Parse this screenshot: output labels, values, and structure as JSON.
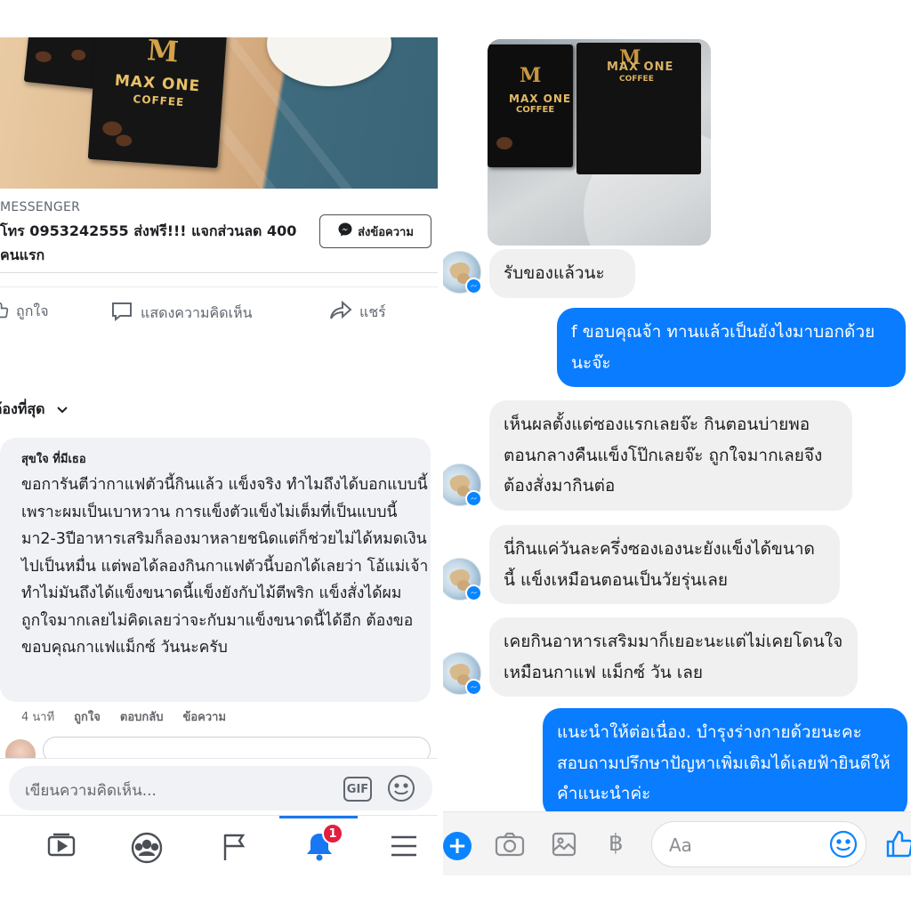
{
  "post": {
    "brand_logo_letter": "M",
    "brand_name_line1": "MAX ONE",
    "brand_name_line2": "COFFEE",
    "source_label": "MESSENGER",
    "ad_text": "โทร 0953242555 ส่งฟรี!!! แจกส่วนลด 400 คนแรก",
    "send_message_label": "ส่งข้อความ",
    "like_label": "ถูกใจ",
    "comment_label": "แสดงความคิดเห็น",
    "share_label": "แชร์",
    "sort_label": "ต้องที่สุด"
  },
  "comment": {
    "author": "สุขใจ ที่มีเธอ",
    "text": "ขอการันตีว่ากาแฟตัวนี้กินแล้ว แข็งจริง ทำไมถึงได้บอกแบบนี้เพราะผมเป็นเบาหวาน การแข็งตัวแข็งไม่เต็มที่เป็นแบบนี้มา2-3ปีอาหารเสริมก็ลองมาหลายชนิดแต่ก็ช่วยไม่ได้หมดเงินไปเป็นหมื่น แต่พอได้ลองกินกาแฟตัวนี้บอกได้เลยว่า โอ้แม่เจ้าทำไม่มันถึงได้แข็งขนาดนี้แข็งยังกับไม้ตีพริก แข็งสั่งได้ผมถูกใจมากเลยไม่คิดเลยว่าจะกับมาแข็งขนาดนี้ได้อีก ต้องขอขอบคุณกาแฟแม็กซ์ วันนะครับ",
    "time": "4 นาที",
    "like": "ถูกใจ",
    "reply": "ตอบกลับ",
    "message": "ข้อความ"
  },
  "composer": {
    "placeholder": "เขียนความคิดเห็น...",
    "gif_label": "GIF"
  },
  "bottom_nav": {
    "notification_count": "1",
    "accent": "#1877f2"
  },
  "chat": {
    "photo_brand_line1": "MAX ONE",
    "photo_brand_line2": "COFFEE",
    "messages": [
      {
        "from": "them",
        "text": "รับของแล้วนะ"
      },
      {
        "from": "me",
        "text": "f ขอบคุณจ้า ทานแล้วเป็นยังไงมาบอกด้วยนะจ๊ะ"
      },
      {
        "from": "them",
        "text": "เห็นผลตั้งแต่ซองแรกเลยจ๊ะ กินตอนบ่ายพอตอนกลางคืนแข็งโป๊กเลยจ๊ะ ถูกใจมากเลยจึงต้องสั่งมากินต่อ"
      },
      {
        "from": "them",
        "text": "นี่กินแค่วันละครึ่งซองเองนะยังแข็งได้ขนาดนี้ แข็งเหมือนตอนเป็นวัยรุ่นเลย"
      },
      {
        "from": "them",
        "text": "เคยกินอาหารเสริมมาก็เยอะนะแต่ไม่เคยโดนใจเหมือนกาแฟ แม็กซ์ วัน เลย"
      },
      {
        "from": "me",
        "text": "แนะนำให้ต่อเนื่อง. บำรุงร่างกายด้วยนะคะสอบถามปรึกษาปัญหาเพิ่มเติมได้เลยฟ้ายินดีให้คำแนะนำค่ะ"
      }
    ],
    "composer_placeholder": "Aa",
    "out_bubble_color": "#0a7cff",
    "in_bubble_color": "#f0f0f0"
  }
}
